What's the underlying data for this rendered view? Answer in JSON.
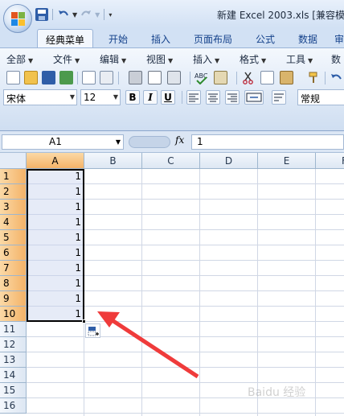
{
  "window": {
    "title": "新建 Excel 2003.xls  [兼容模"
  },
  "quick_access": {
    "icons": [
      "save-icon",
      "undo-icon",
      "redo-icon",
      "customize-icon"
    ]
  },
  "tabs": [
    "经典菜单",
    "开始",
    "插入",
    "页面布局",
    "公式",
    "数据",
    "审"
  ],
  "active_tab": "经典菜单",
  "classic_menu": [
    "全部",
    "文件",
    "编辑",
    "视图",
    "插入",
    "格式",
    "工具",
    "数"
  ],
  "font": {
    "name": "宋体",
    "size": "12",
    "bold_label": "B",
    "italic_label": "I",
    "underline_label": "U",
    "number_format": "常规"
  },
  "formula_bar": {
    "name_box": "A1",
    "fx_label": "fx",
    "value": "1"
  },
  "columns": [
    "A",
    "B",
    "C",
    "D",
    "E",
    "F"
  ],
  "rows": [
    "1",
    "2",
    "3",
    "4",
    "5",
    "6",
    "7",
    "8",
    "9",
    "10",
    "11",
    "12",
    "13",
    "14",
    "15",
    "16"
  ],
  "column_a_values": [
    "1",
    "1",
    "1",
    "1",
    "1",
    "1",
    "1",
    "1",
    "1",
    "1"
  ],
  "selection": "A1:A10",
  "colors": {
    "selected_header": "#f4b368",
    "selection_fill": "#c7d3ed",
    "annotation_arrow": "#ef3b3b"
  },
  "watermark": "Baidu 经验"
}
